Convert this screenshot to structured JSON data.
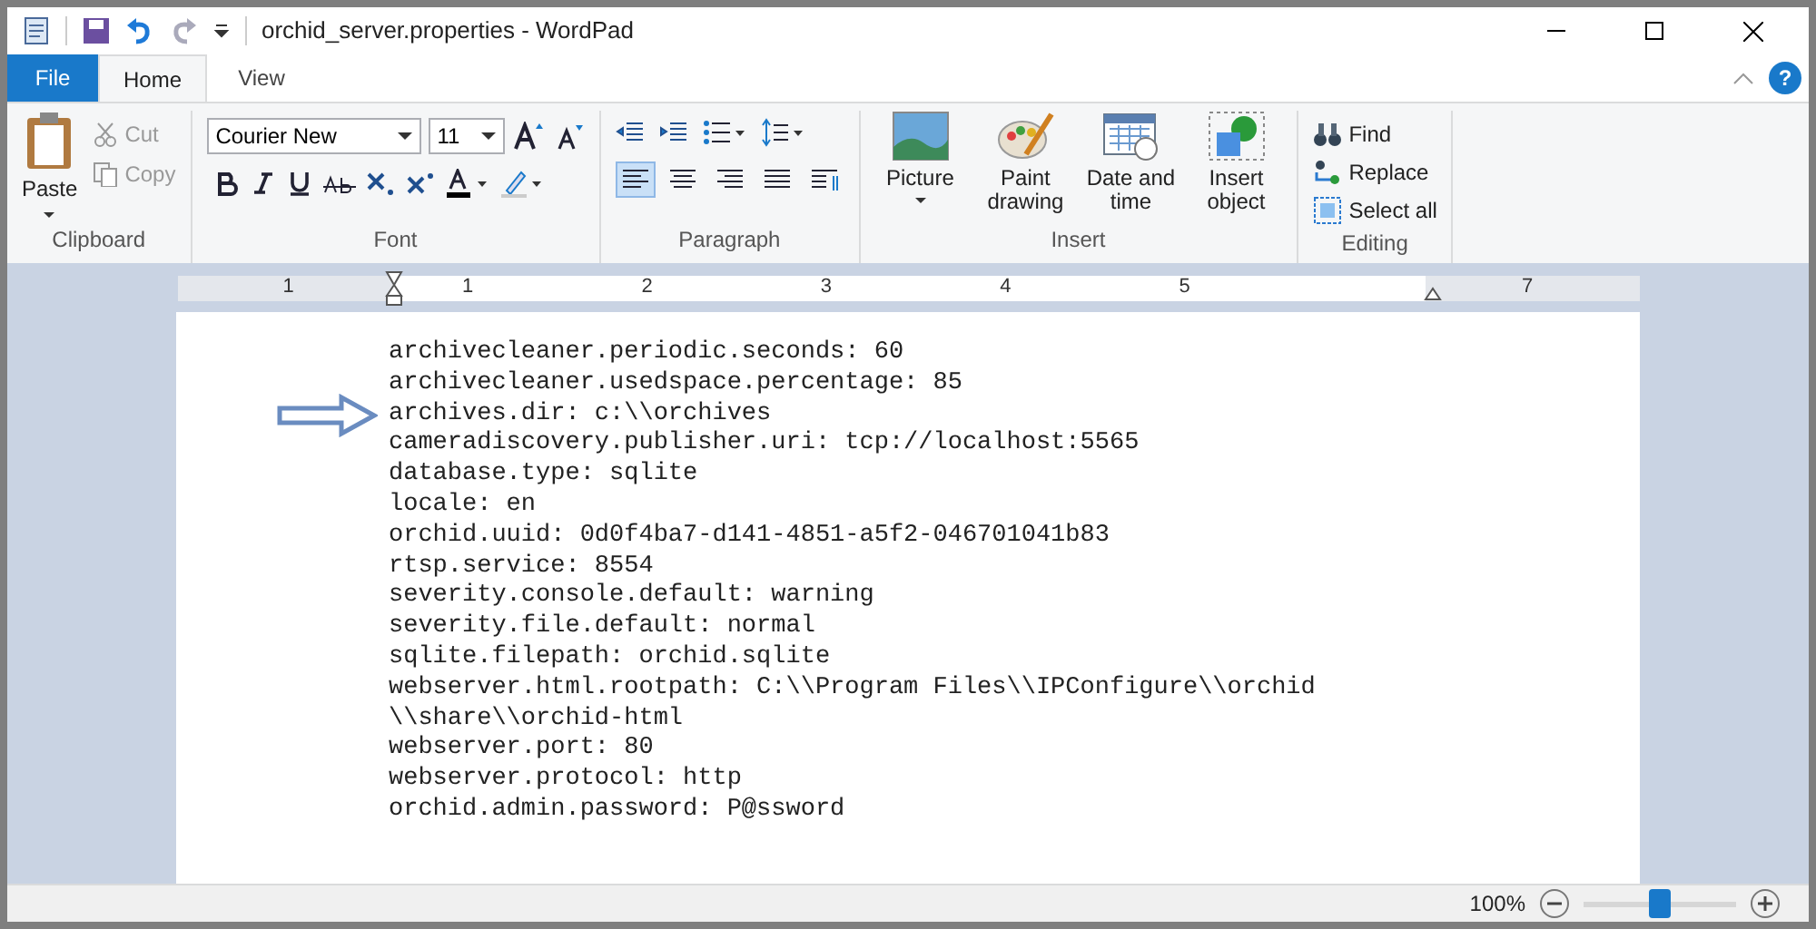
{
  "window": {
    "title": "orchid_server.properties - WordPad"
  },
  "tabs": [
    {
      "label": "File",
      "kind": "file",
      "selected": false
    },
    {
      "label": "Home",
      "kind": "tab",
      "selected": true
    },
    {
      "label": "View",
      "kind": "tab",
      "selected": false
    }
  ],
  "help": "?",
  "ribbon": {
    "clipboard": {
      "paste": "Paste",
      "cut": "Cut",
      "copy": "Copy",
      "label": "Clipboard"
    },
    "font": {
      "family": "Courier New",
      "size": "11",
      "label": "Font"
    },
    "paragraph": {
      "label": "Paragraph"
    },
    "insert": {
      "items": [
        "Picture",
        "Paint drawing",
        "Date and time",
        "Insert object"
      ],
      "label": "Insert"
    },
    "editing": {
      "items": [
        "Find",
        "Replace",
        "Select all"
      ],
      "label": "Editing"
    }
  },
  "ruler": [
    "1",
    "1",
    "2",
    "3",
    "4",
    "5",
    "7"
  ],
  "document": {
    "lines": [
      "archivecleaner.periodic.seconds: 60",
      "archivecleaner.usedspace.percentage: 85",
      "archives.dir: c:\\\\orchives",
      "cameradiscovery.publisher.uri: tcp://localhost:5565",
      "database.type: sqlite",
      "locale: en",
      "orchid.uuid: 0d0f4ba7-d141-4851-a5f2-046701041b83",
      "rtsp.service: 8554",
      "severity.console.default: warning",
      "severity.file.default: normal",
      "sqlite.filepath: orchid.sqlite",
      "webserver.html.rootpath: C:\\\\Program Files\\\\IPConfigure\\\\orchid",
      "\\\\share\\\\orchid-html",
      "webserver.port: 80",
      "webserver.protocol: http",
      "orchid.admin.password: P@ssword"
    ]
  },
  "status_bar": {
    "zoom": "100%",
    "level": 0.5
  }
}
